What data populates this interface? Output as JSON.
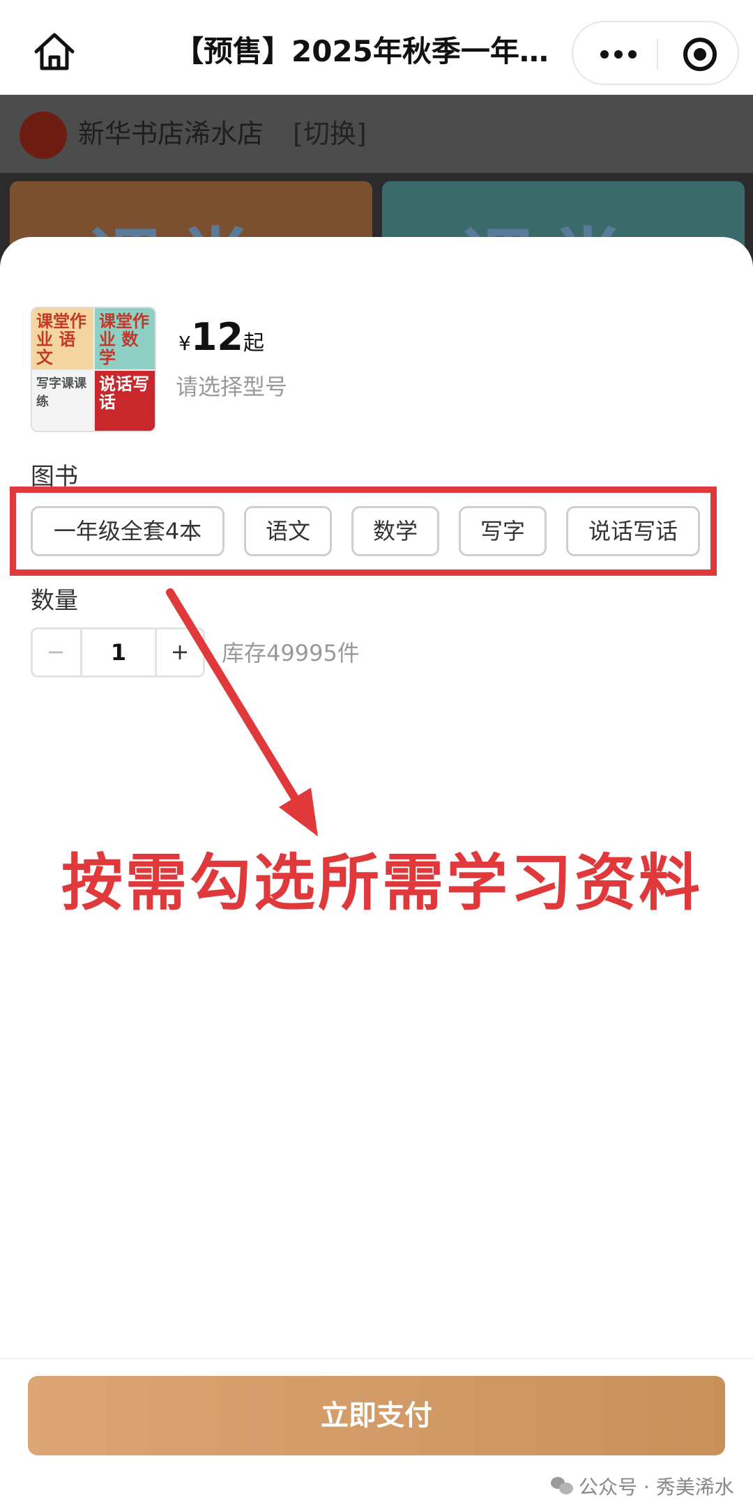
{
  "nav": {
    "title": "【预售】2025年秋季一年…"
  },
  "shop": {
    "name": "新华书店浠水店",
    "switch_label": "[切换]",
    "banner_word": "课堂"
  },
  "product": {
    "currency": "¥",
    "price": "12",
    "price_suffix": "起",
    "hint": "请选择型号",
    "thumb_labels": [
      "课堂作业 语文",
      "课堂作业 数学",
      "写字课课练",
      "说话写话"
    ]
  },
  "options": {
    "label": "图书",
    "items": [
      "一年级全套4本",
      "语文",
      "数学",
      "写字",
      "说话写话"
    ]
  },
  "quantity": {
    "label": "数量",
    "minus": "−",
    "value": "1",
    "plus": "+",
    "stock": "库存49995件"
  },
  "annotation": {
    "callout": "按需勾选所需学习资料",
    "color": "#e0393c"
  },
  "footer": {
    "pay_label": "立即支付",
    "watermark": "公众号 · 秀美浠水"
  }
}
